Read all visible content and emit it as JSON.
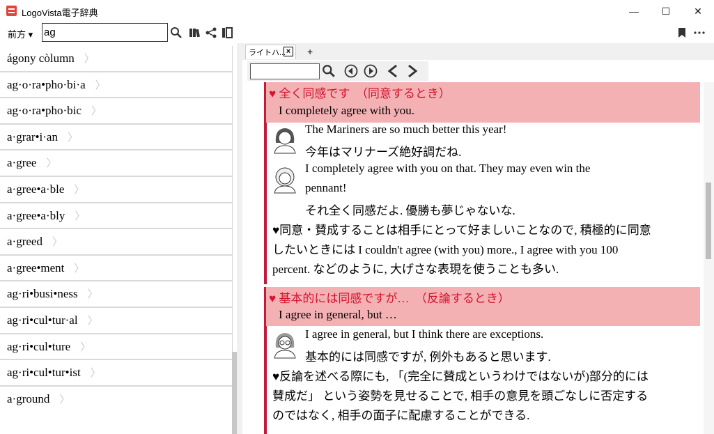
{
  "app": {
    "title": "LogoVista電子辞典"
  },
  "window": {
    "minimize": "—",
    "maximize": "☐",
    "close": "✕"
  },
  "toolbar": {
    "direction": "前方 ▾",
    "search_value": "ag"
  },
  "word_list": [
    {
      "word": "ágony còlumn"
    },
    {
      "word": "ag·o·ra•pho·bi·a"
    },
    {
      "word": "ag·o·ra•pho·bic"
    },
    {
      "word": "a·grar•i·an"
    },
    {
      "word": "a·gree"
    },
    {
      "word": "a·gree•a·ble"
    },
    {
      "word": "a·gree•a·bly"
    },
    {
      "word": "a·greed"
    },
    {
      "word": "a·gree•ment"
    },
    {
      "word": "ag·ri•busi•ness"
    },
    {
      "word": "ag·ri•cul•tur·al"
    },
    {
      "word": "ag·ri•cul•ture"
    },
    {
      "word": "ag·ri•cul•tur•ist"
    },
    {
      "word": "a·ground"
    }
  ],
  "tabs": {
    "active": "ライトハ...",
    "add": "+"
  },
  "content": {
    "section1": {
      "heading": "♥ 全く同感です　（同意するとき）",
      "subheading": "I completely agree with you.",
      "lines": [
        "The Mariners are so much better this year!",
        "今年はマリナーズ絶好調だね.",
        "I completely agree with you on that. They may even win the",
        "pennant!",
        "それ全く同感だよ. 優勝も夢じゃないな."
      ],
      "notes": [
        "♥同意・賛成することは相手にとって好ましいことなので, 積極的に同意",
        "したいときには I couldn't agree (with you) more., I agree with you 100",
        "percent. などのように, 大げさな表現を使うことも多い."
      ]
    },
    "section2": {
      "heading": "♥ 基本的には同感ですが…　（反論するとき）",
      "subheading": "I agree in general, but …",
      "lines": [
        "I agree in general, but I think there are exceptions.",
        "基本的には同感ですが, 例外もあると思います."
      ],
      "notes": [
        "♥反論を述べる際にも, 「(完全に賛成というわけではないが)部分的には",
        "賛成だ」 という姿勢を見せることで, 相手の意見を頭ごなしに否定する",
        "のではなく, 相手の面子に配慮することができる."
      ]
    }
  }
}
